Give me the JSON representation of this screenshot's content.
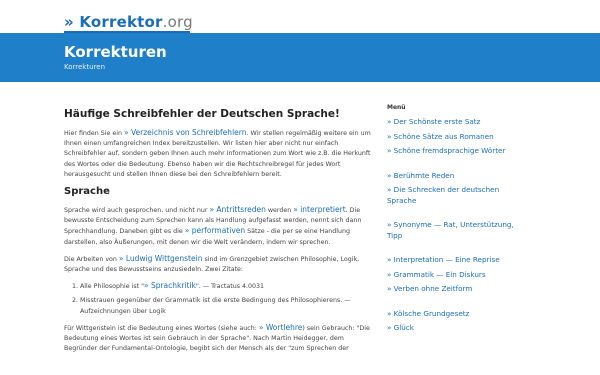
{
  "header": {
    "logo": {
      "prefix": "»",
      "name": "Korrektor",
      "tld": ".org"
    },
    "title": "Korrekturen",
    "subtitle": "Korrekturen"
  },
  "article": {
    "heading": "Häufige Schreibfehler der Deutschen Sprache!",
    "p1": {
      "before": "Hier finden Sie ein ",
      "link": "» Verzeichnis von Schreibfehlern",
      "after": ". Wir stellen regelmäßig weitere ein um Ihnen einen umfangreichen Index bereitzustellen. Wir listen hier aber nicht nur einfach Schreibfehler auf, sondern geben Ihnen auch mehr Informationen zum Wort wie z.B. die Herkunft des Wortes oder die Bedeutung. Ebenso haben wir die Rechtschreibregel für jedes Wort herausgesucht und stellen Ihnen diese bei den Schreibfehlern bereit."
    },
    "section_heading": "Sprache",
    "p2": {
      "t1": "Sprache wird auch gesprochen, und nicht nur ",
      "l1": "» Antrittsreden",
      "t2": " werden ",
      "l2": "» interpretiert",
      "t3": ". Die bewusste Entscheidung zum Sprechen kann als Handlung aufgefasst werden, nennt sich dann Sprechhandlung. Daneben gibt es die ",
      "l3": "» performativen",
      "t4": " Sätze - die per se eine Handlung darstellen, also Äußerungen, mit denen wir die Welt verändern, indem wir sprechen."
    },
    "p3": {
      "t1": "Die Arbeiten von ",
      "l1": "» Ludwig Wittgenstein",
      "t2": " sind im Grenzgebiet zwischen Philosophie, Logik, Sprache und des Bewusstseins anzusiedeln. Zwei Zitate:"
    },
    "quotes": [
      {
        "t1": "Alle Philosophie ist \"",
        "l1": "» Sprachkritik",
        "t2": "\". — Tractatus 4.0031"
      },
      {
        "t1": "Misstrauen gegenüber der Grammatik ist die erste Bedingung des Philosophierens. — Aufzeichnungen über Logik"
      }
    ],
    "p4": {
      "t1": "Für Wittgenstein ist die Bedeutung eines Wortes (siehe auch: ",
      "l1": "» Wortlehre",
      "t2": ") sein Gebrauch: \"Die Bedeutung eines Wortes ist sein Gebrauch in der Sprache\". Nach Martin Heidegger, dem Begründer der Fundamental-Ontologie, begibt sich der Mensch als der \"zum Sprechen der"
    }
  },
  "sidebar": {
    "title": "Menü",
    "groups": [
      [
        "» Der Schönste erste Satz",
        "» Schöne Sätze aus Romanen",
        "» Schöne fremdsprachige Wörter"
      ],
      [
        "» Berühmte Reden",
        "» Die Schrecken der deutschen Sprache"
      ],
      [
        "» Synonyme — Rat, Unterstützung, Tipp"
      ],
      [
        "» Interpretation — Eine Reprise",
        "» Grammatik — Ein Diskurs",
        "» Verben ohne Zeitform"
      ],
      [
        "» Kölsche Grundgesetz",
        "» Glück"
      ]
    ]
  }
}
